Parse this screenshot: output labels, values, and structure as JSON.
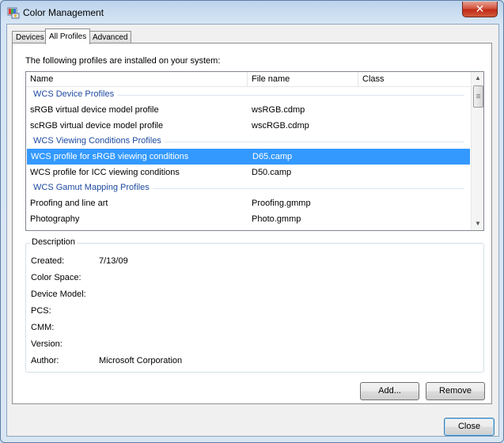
{
  "window": {
    "title": "Color Management",
    "close_glyph": "✕",
    "app_icon": "color-management-icon"
  },
  "tabs": [
    {
      "label": "Devices",
      "active": false
    },
    {
      "label": "All Profiles",
      "active": true
    },
    {
      "label": "Advanced",
      "active": false
    }
  ],
  "profiles": {
    "intro": "The following profiles are installed on your system:",
    "columns": [
      "Name",
      "File name",
      "Class"
    ],
    "groups": [
      {
        "label": "WCS Device Profiles",
        "rows": [
          {
            "name": "sRGB virtual device model profile",
            "file": "wsRGB.cdmp"
          },
          {
            "name": "scRGB virtual device model profile",
            "file": "wscRGB.cdmp"
          }
        ]
      },
      {
        "label": "WCS Viewing Conditions Profiles",
        "rows": [
          {
            "name": "WCS profile for sRGB viewing conditions",
            "file": "D65.camp",
            "selected": true
          },
          {
            "name": "WCS profile for ICC viewing conditions",
            "file": "D50.camp"
          }
        ]
      },
      {
        "label": "WCS Gamut Mapping Profiles",
        "rows": [
          {
            "name": "Proofing and line art",
            "file": "Proofing.gmmp"
          },
          {
            "name": "Photography",
            "file": "Photo.gmmp"
          }
        ]
      }
    ]
  },
  "description": {
    "legend": "Description",
    "properties": [
      {
        "label": "Created:",
        "value": "7/13/09"
      },
      {
        "label": "Color Space:",
        "value": ""
      },
      {
        "label": "Device Model:",
        "value": ""
      },
      {
        "label": "PCS:",
        "value": ""
      },
      {
        "label": "CMM:",
        "value": ""
      },
      {
        "label": "Version:",
        "value": ""
      },
      {
        "label": "Author:",
        "value": "Microsoft Corporation"
      }
    ]
  },
  "buttons": {
    "add": "Add...",
    "remove": "Remove",
    "close": "Close"
  },
  "colors": {
    "selection": "#3399ff",
    "group_header": "#1e4aa0"
  }
}
